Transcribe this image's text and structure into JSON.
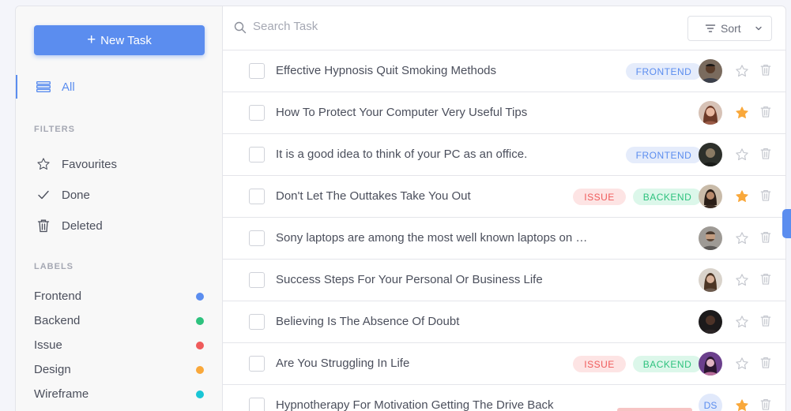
{
  "sidebar": {
    "new_task_label": "New Task",
    "all_label": "All",
    "filters_title": "FILTERS",
    "filters": [
      {
        "label": "Favourites",
        "icon": "star-outline-icon"
      },
      {
        "label": "Done",
        "icon": "check-icon"
      },
      {
        "label": "Deleted",
        "icon": "trash-icon"
      }
    ],
    "labels_title": "LABELS",
    "labels": [
      {
        "label": "Frontend",
        "color": "#5b8def"
      },
      {
        "label": "Backend",
        "color": "#2ec27e"
      },
      {
        "label": "Issue",
        "color": "#ef5b5b"
      },
      {
        "label": "Design",
        "color": "#f9a83b"
      },
      {
        "label": "Wireframe",
        "color": "#1ac6d6"
      }
    ]
  },
  "search": {
    "placeholder": "Search Task",
    "value": ""
  },
  "sort": {
    "label": "Sort"
  },
  "tasks": [
    {
      "title": "Effective Hypnosis Quit Smoking Methods",
      "tags": [
        "FRONTEND"
      ],
      "starred": false,
      "avatar": "avatar-1"
    },
    {
      "title": "How To Protect Your Computer Very Useful Tips",
      "tags": [],
      "starred": true,
      "avatar": "avatar-2"
    },
    {
      "title": "It is a good idea to think of your PC as an office.",
      "tags": [
        "FRONTEND"
      ],
      "starred": false,
      "avatar": "avatar-3"
    },
    {
      "title": "Don't Let The Outtakes Take You Out",
      "tags": [
        "ISSUE",
        "BACKEND"
      ],
      "starred": true,
      "avatar": "avatar-4"
    },
    {
      "title": "Sony laptops are among the most well known laptops on …",
      "tags": [],
      "starred": false,
      "avatar": "avatar-5"
    },
    {
      "title": "Success Steps For Your Personal Or Business Life",
      "tags": [],
      "starred": false,
      "avatar": "avatar-6"
    },
    {
      "title": "Believing Is The Absence Of Doubt",
      "tags": [],
      "starred": false,
      "avatar": "avatar-7"
    },
    {
      "title": "Are You Struggling In Life",
      "tags": [
        "ISSUE",
        "BACKEND"
      ],
      "starred": false,
      "avatar": "avatar-8"
    },
    {
      "title": "Hypnotherapy For Motivation Getting The Drive Back",
      "tags": [],
      "starred": true,
      "avatar_initials": "DS"
    }
  ],
  "colors": {
    "accent": "#5b8def",
    "star_active": "#f9a83b",
    "star_inactive": "#c5c8cf"
  }
}
